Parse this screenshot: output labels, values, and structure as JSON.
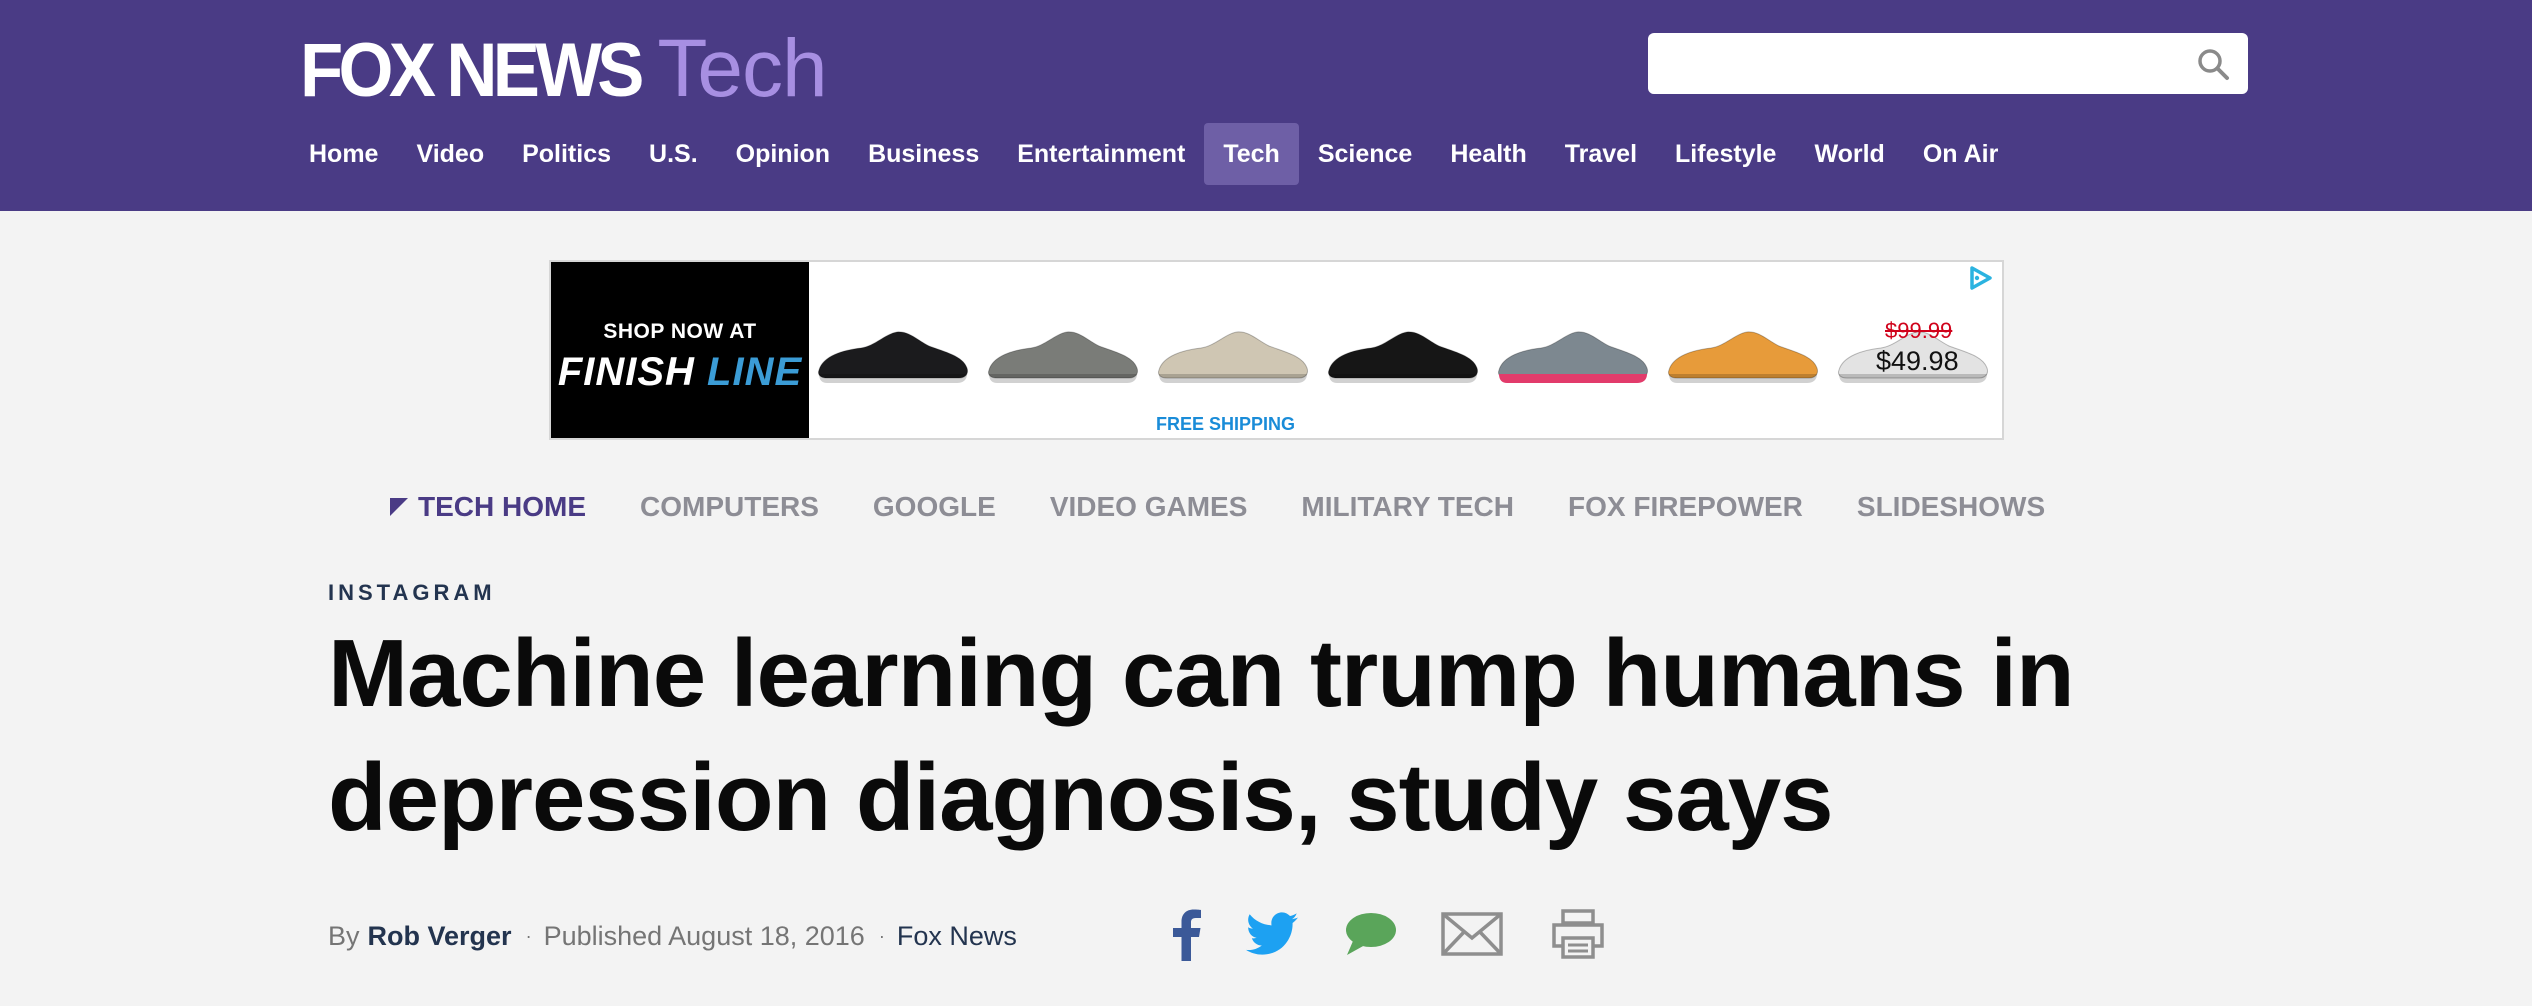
{
  "header": {
    "logo_main": "FOX NEWS",
    "logo_sub": "Tech",
    "search": {
      "value": "",
      "placeholder": ""
    },
    "nav": [
      {
        "label": "Home"
      },
      {
        "label": "Video"
      },
      {
        "label": "Politics"
      },
      {
        "label": "U.S."
      },
      {
        "label": "Opinion"
      },
      {
        "label": "Business"
      },
      {
        "label": "Entertainment"
      },
      {
        "label": "Tech",
        "active": true
      },
      {
        "label": "Science"
      },
      {
        "label": "Health"
      },
      {
        "label": "Travel"
      },
      {
        "label": "Lifestyle"
      },
      {
        "label": "World"
      },
      {
        "label": "On Air"
      }
    ]
  },
  "ad": {
    "shop_now": "SHOP NOW AT",
    "brand_part1": "FINISH ",
    "brand_part2": "LINE",
    "price_old": "$99.99",
    "price_new": "$49.98",
    "shipping": "FREE SHIPPING",
    "shoe_colors": [
      "#1b1b1d",
      "#7a7c78",
      "#cfc6b3",
      "#161616",
      "#7d8890",
      "#e79b3a",
      "#e3e3e3"
    ]
  },
  "subnav": {
    "items": [
      {
        "label": "TECH HOME",
        "active": true
      },
      {
        "label": "COMPUTERS"
      },
      {
        "label": "GOOGLE"
      },
      {
        "label": "VIDEO GAMES"
      },
      {
        "label": "MILITARY TECH"
      },
      {
        "label": "FOX FIREPOWER"
      },
      {
        "label": "SLIDESHOWS"
      }
    ]
  },
  "article": {
    "eyebrow": "INSTAGRAM",
    "headline": "Machine learning can trump humans in depression diagnosis, study says",
    "byline_prefix": "By",
    "author": "Rob Verger",
    "dot": "·",
    "published": "Published August 18, 2016",
    "source": "Fox News"
  },
  "share": {
    "icons": [
      "facebook-icon",
      "twitter-icon",
      "comment-icon",
      "email-icon",
      "print-icon"
    ],
    "colors": {
      "facebook": "#3b5998",
      "twitter": "#1da1f2",
      "comment": "#5aa55a",
      "email": "#8e8e8e",
      "print": "#8e8e8e"
    }
  },
  "colors": {
    "brand_purple": "#4a3b85",
    "active_tab": "#6e5fa6",
    "tech_lilac": "#a78fe2"
  }
}
